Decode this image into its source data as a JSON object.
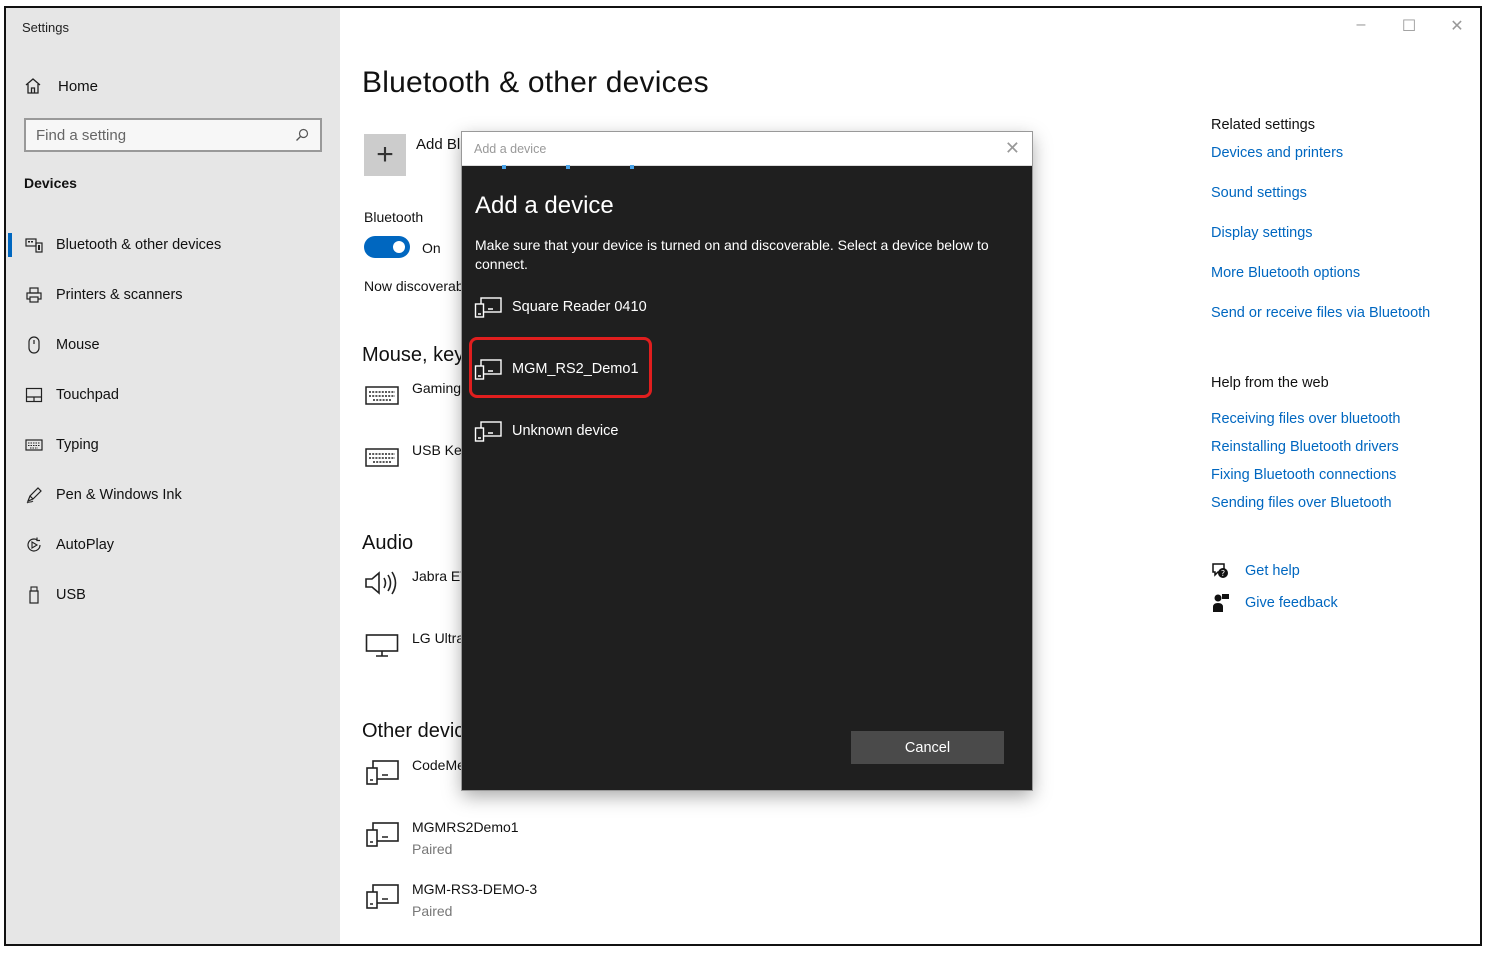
{
  "window": {
    "title": "Settings",
    "controls": {
      "minimize": "–",
      "maximize": "☐",
      "close": "✕"
    }
  },
  "sidebar": {
    "home_label": "Home",
    "search_placeholder": "Find a setting",
    "section_label": "Devices",
    "items": [
      {
        "label": "Bluetooth & other devices",
        "icon": "bluetooth-devices-icon",
        "selected": true
      },
      {
        "label": "Printers & scanners",
        "icon": "printer-icon",
        "selected": false
      },
      {
        "label": "Mouse",
        "icon": "mouse-icon",
        "selected": false
      },
      {
        "label": "Touchpad",
        "icon": "touchpad-icon",
        "selected": false
      },
      {
        "label": "Typing",
        "icon": "keyboard-icon",
        "selected": false
      },
      {
        "label": "Pen & Windows Ink",
        "icon": "pen-icon",
        "selected": false
      },
      {
        "label": "AutoPlay",
        "icon": "autoplay-icon",
        "selected": false
      },
      {
        "label": "USB",
        "icon": "usb-icon",
        "selected": false
      }
    ]
  },
  "main": {
    "title": "Bluetooth & other devices",
    "add_label": "Add Bl",
    "bluetooth_label": "Bluetooth",
    "bluetooth_state": "On",
    "discoverable_text": "Now discoverab",
    "groups": {
      "mouse_keyboard": {
        "title": "Mouse, key",
        "devices": [
          {
            "name": "Gaming",
            "icon": "keyboard-icon"
          },
          {
            "name": "USB Key",
            "icon": "keyboard-icon"
          }
        ]
      },
      "audio": {
        "title": "Audio",
        "devices": [
          {
            "name": "Jabra EV",
            "icon": "speaker-icon"
          },
          {
            "name": "LG Ultra",
            "icon": "monitor-icon"
          }
        ]
      },
      "other": {
        "title": "Other devic",
        "devices": [
          {
            "name": "CodeMe",
            "status": "",
            "icon": "device-icon"
          },
          {
            "name": "MGMRS2Demo1",
            "status": "Paired",
            "icon": "device-icon"
          },
          {
            "name": "MGM-RS3-DEMO-3",
            "status": "Paired",
            "icon": "device-icon"
          }
        ]
      }
    }
  },
  "related": {
    "heading": "Related settings",
    "links": [
      "Devices and printers",
      "Sound settings",
      "Display settings",
      "More Bluetooth options",
      "Send or receive files via Bluetooth"
    ],
    "help_heading": "Help from the web",
    "help_links": [
      "Receiving files over bluetooth",
      "Reinstalling Bluetooth drivers",
      "Fixing Bluetooth connections",
      "Sending files over Bluetooth"
    ],
    "get_help": "Get help",
    "give_feedback": "Give feedback"
  },
  "dialog": {
    "window_title": "Add a device",
    "close": "✕",
    "heading": "Add a device",
    "description": "Make sure that your device is turned on and discoverable. Select a device below to connect.",
    "devices": [
      {
        "name": "Square Reader 0410",
        "highlighted": false
      },
      {
        "name": "MGM_RS2_Demo1",
        "highlighted": true
      },
      {
        "name": "Unknown device",
        "highlighted": false
      }
    ],
    "cancel_label": "Cancel"
  },
  "colors": {
    "accent": "#0067c0",
    "sidebar_bg": "#e6e6e6",
    "dialog_bg": "#1f1f1f",
    "highlight": "#e01e1e",
    "cancel_bg": "#4a4a4a"
  }
}
